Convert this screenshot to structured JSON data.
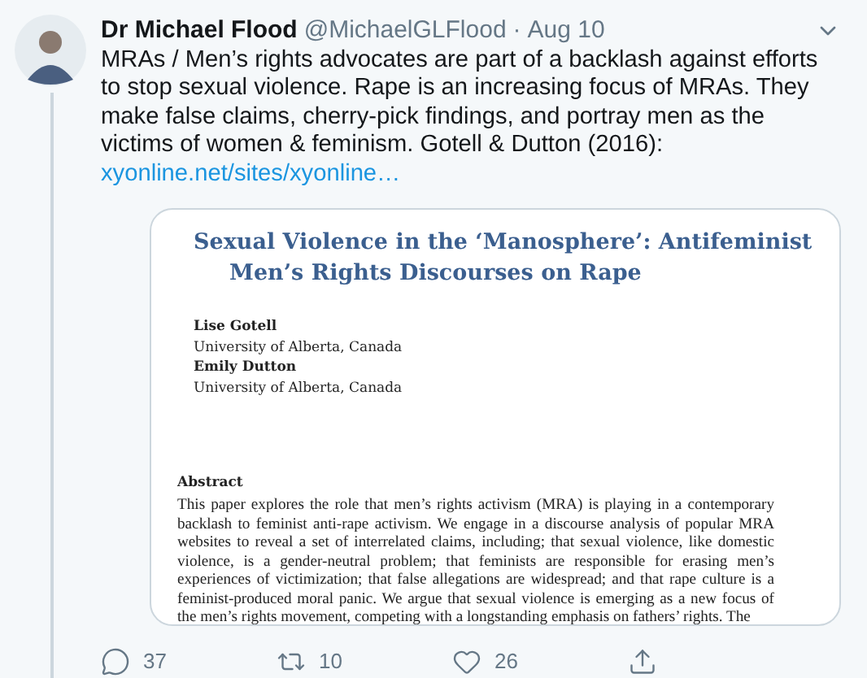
{
  "tweet": {
    "author": "Dr Michael Flood",
    "handle": "@MichaelGLFlood",
    "separator": "·",
    "date": "Aug 10",
    "text": "MRAs / Men’s rights advocates are part of a backlash against efforts to stop sexual violence. Rape is an increasing focus of MRAs. They make false claims, cherry-pick findings, and portray men as the victims of women & feminism. Gotell & Dutton (2016):",
    "link": "xyonline.net/sites/xyonline…",
    "document": {
      "title_lines": [
        "Sexual Violence in the ‘Manosphere’: Antifeminist",
        "Men’s Rights Discourses on Rape"
      ],
      "authors": [
        {
          "name": "Lise Gotell",
          "affiliation": "University of Alberta, Canada"
        },
        {
          "name": "Emily Dutton",
          "affiliation": "University of Alberta, Canada"
        }
      ],
      "abstract_heading": "Abstract",
      "abstract": "This paper explores the role that men’s rights activism (MRA) is playing in a contemporary backlash to feminist anti-rape activism. We engage in a discourse analysis of popular MRA websites to reveal a set of interrelated claims, including; that sexual violence, like domestic violence, is a gender-neutral problem; that feminists are responsible for erasing men’s experiences of victimization; that false allegations are widespread; and that rape culture is a feminist-produced moral panic. We argue that sexual violence is emerging as a new focus of the men’s rights movement, competing with a longstanding emphasis on fathers’ rights. The"
    },
    "actions": [
      {
        "kind": "reply",
        "count": "37"
      },
      {
        "kind": "retweet",
        "count": "10"
      },
      {
        "kind": "like",
        "count": "26"
      },
      {
        "kind": "share"
      }
    ]
  }
}
